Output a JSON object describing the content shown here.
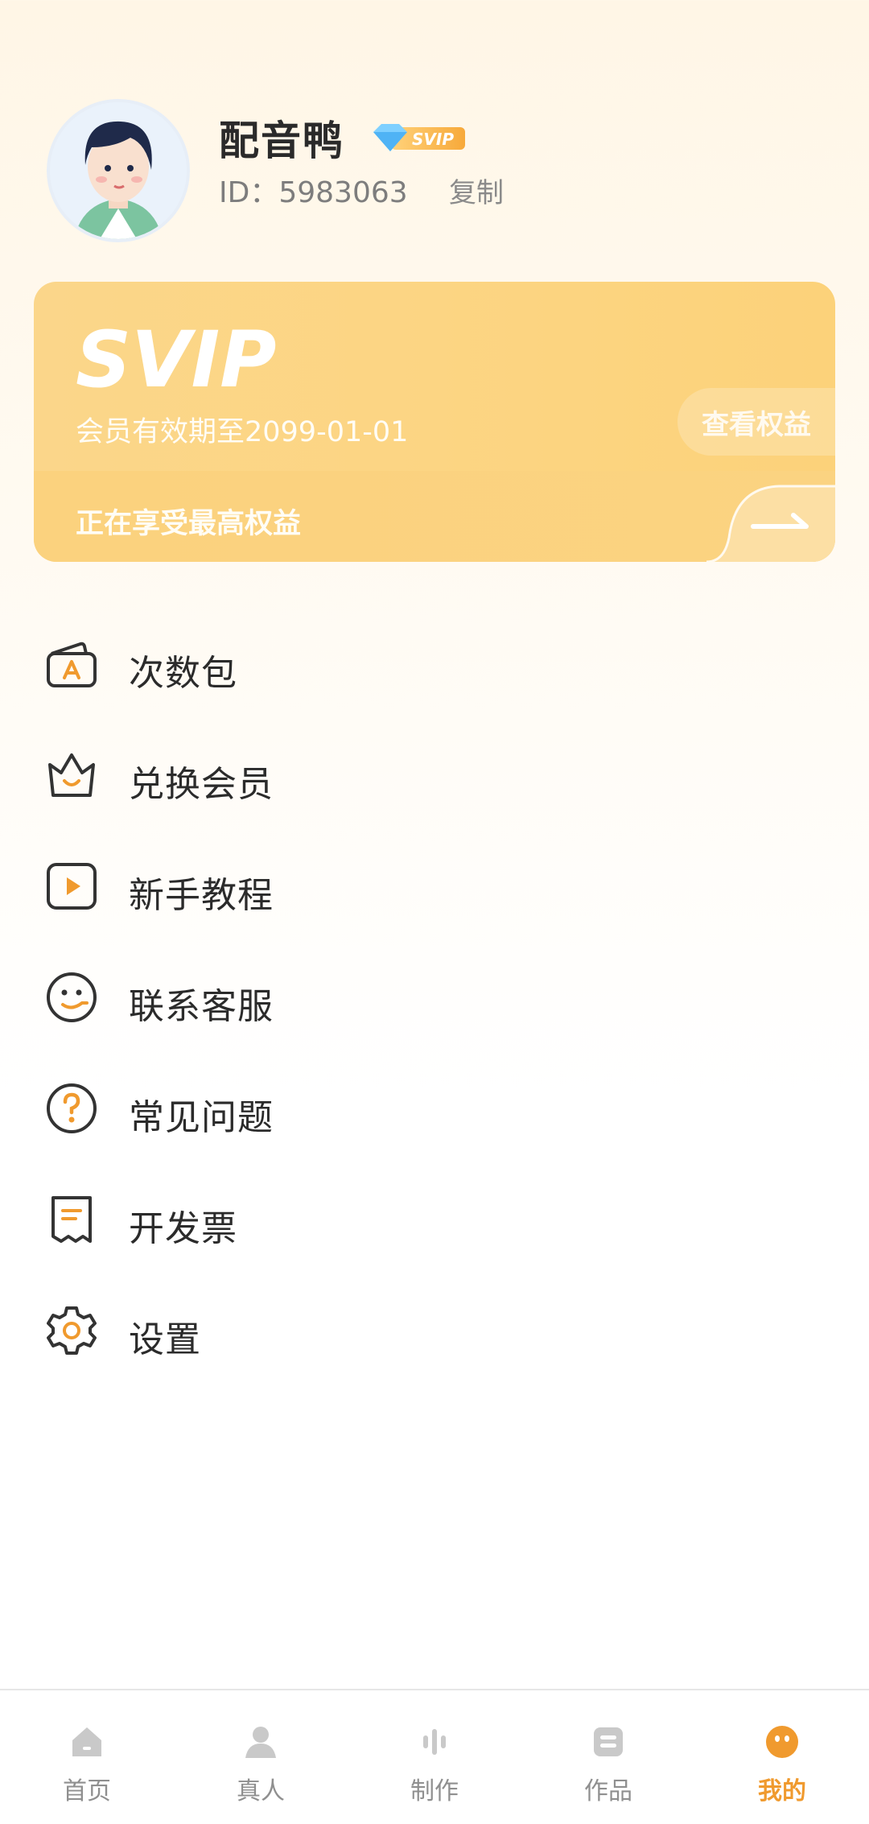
{
  "profile": {
    "name": "配音鸭",
    "badge": "SVIP",
    "id_text": "ID：5983063",
    "copy_label": "复制"
  },
  "membership_card": {
    "logo": "SVIP",
    "expire_text": "会员有效期至2099-01-01",
    "rights_button": "查看权益",
    "enjoy_text": "正在享受最高权益"
  },
  "menu": [
    {
      "label": "次数包",
      "icon": "ticket-pack-icon"
    },
    {
      "label": "兑换会员",
      "icon": "crown-icon"
    },
    {
      "label": "新手教程",
      "icon": "play-tutorial-icon"
    },
    {
      "label": "联系客服",
      "icon": "customer-service-icon"
    },
    {
      "label": "常见问题",
      "icon": "question-icon"
    },
    {
      "label": "开发票",
      "icon": "invoice-icon"
    },
    {
      "label": "设置",
      "icon": "gear-icon"
    }
  ],
  "tabs": [
    {
      "label": "首页",
      "icon": "home-icon"
    },
    {
      "label": "真人",
      "icon": "person-icon"
    },
    {
      "label": "制作",
      "icon": "audio-wave-icon"
    },
    {
      "label": "作品",
      "icon": "works-icon"
    },
    {
      "label": "我的",
      "icon": "me-icon",
      "active": true
    }
  ],
  "colors": {
    "accent": "#f09a2e",
    "card": "#fcd583",
    "icon_dark": "#333333"
  }
}
